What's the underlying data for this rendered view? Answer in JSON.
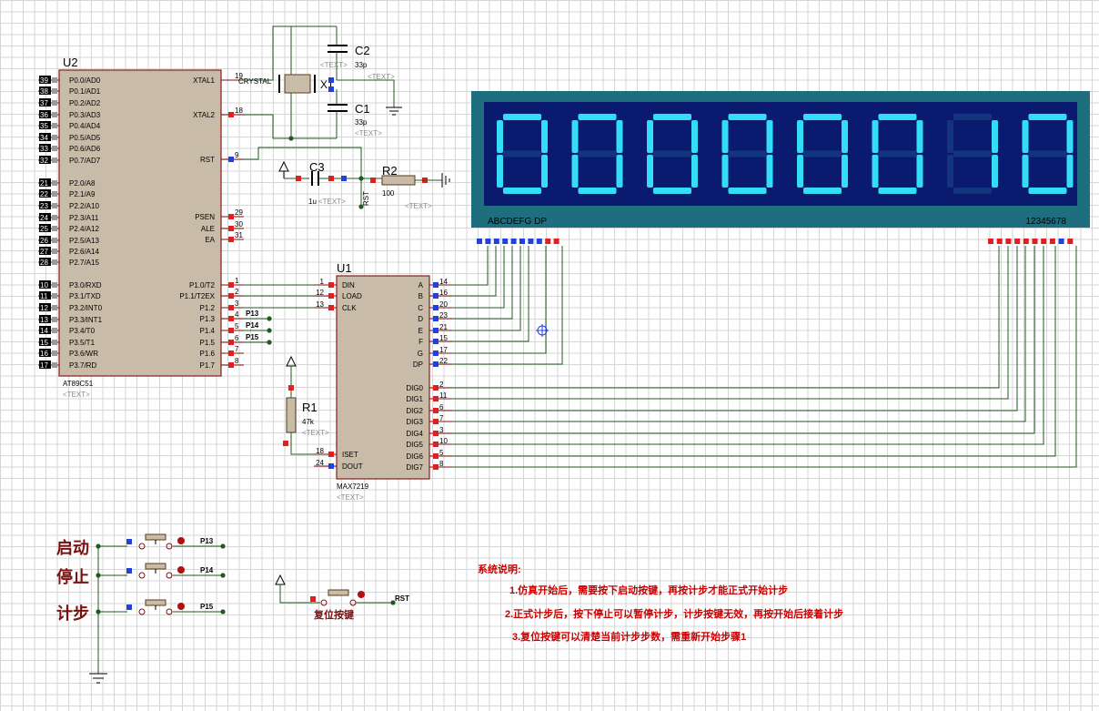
{
  "u2": {
    "ref": "U2",
    "part": "AT89C51",
    "text": "<TEXT>",
    "left_pins": [
      {
        "num": "39",
        "name": "P0.0/AD0"
      },
      {
        "num": "38",
        "name": "P0.1/AD1"
      },
      {
        "num": "37",
        "name": "P0.2/AD2"
      },
      {
        "num": "36",
        "name": "P0.3/AD3"
      },
      {
        "num": "35",
        "name": "P0.4/AD4"
      },
      {
        "num": "34",
        "name": "P0.5/AD5"
      },
      {
        "num": "33",
        "name": "P0.6/AD6"
      },
      {
        "num": "32",
        "name": "P0.7/AD7"
      },
      {
        "num": "21",
        "name": "P2.0/A8"
      },
      {
        "num": "22",
        "name": "P2.1/A9"
      },
      {
        "num": "23",
        "name": "P2.2/A10"
      },
      {
        "num": "24",
        "name": "P2.3/A11"
      },
      {
        "num": "25",
        "name": "P2.4/A12"
      },
      {
        "num": "26",
        "name": "P2.5/A13"
      },
      {
        "num": "27",
        "name": "P2.6/A14"
      },
      {
        "num": "28",
        "name": "P2.7/A15"
      },
      {
        "num": "10",
        "name": "P3.0/RXD"
      },
      {
        "num": "11",
        "name": "P3.1/TXD"
      },
      {
        "num": "12",
        "name": "P3.2/INT0"
      },
      {
        "num": "13",
        "name": "P3.3/INT1"
      },
      {
        "num": "14",
        "name": "P3.4/T0"
      },
      {
        "num": "15",
        "name": "P3.5/T1"
      },
      {
        "num": "16",
        "name": "P3.6/WR"
      },
      {
        "num": "17",
        "name": "P3.7/RD"
      }
    ],
    "right_pins": [
      {
        "num": "19",
        "name": "XTAL1"
      },
      {
        "num": "18",
        "name": "XTAL2"
      },
      {
        "num": "9",
        "name": "RST"
      },
      {
        "num": "29",
        "name": "PSEN"
      },
      {
        "num": "30",
        "name": "ALE"
      },
      {
        "num": "31",
        "name": "EA"
      },
      {
        "num": "1",
        "name": "P1.0/T2"
      },
      {
        "num": "2",
        "name": "P1.1/T2EX"
      },
      {
        "num": "3",
        "name": "P1.2"
      },
      {
        "num": "4",
        "name": "P1.3"
      },
      {
        "num": "5",
        "name": "P1.4"
      },
      {
        "num": "6",
        "name": "P1.5"
      },
      {
        "num": "7",
        "name": "P1.6"
      },
      {
        "num": "8",
        "name": "P1.7"
      }
    ]
  },
  "u1": {
    "ref": "U1",
    "part": "MAX7219",
    "text": "<TEXT>",
    "left_pins": [
      {
        "num": "1",
        "name": "DIN"
      },
      {
        "num": "12",
        "name": "LOAD"
      },
      {
        "num": "13",
        "name": "CLK"
      },
      {
        "num": "18",
        "name": "ISET"
      },
      {
        "num": "24",
        "name": "DOUT"
      }
    ],
    "right_pins": [
      {
        "num": "14",
        "name": "A"
      },
      {
        "num": "16",
        "name": "B"
      },
      {
        "num": "20",
        "name": "C"
      },
      {
        "num": "23",
        "name": "D"
      },
      {
        "num": "21",
        "name": "E"
      },
      {
        "num": "15",
        "name": "F"
      },
      {
        "num": "17",
        "name": "G"
      },
      {
        "num": "22",
        "name": "DP"
      },
      {
        "num": "2",
        "name": "DIG0"
      },
      {
        "num": "11",
        "name": "DIG1"
      },
      {
        "num": "6",
        "name": "DIG2"
      },
      {
        "num": "7",
        "name": "DIG3"
      },
      {
        "num": "3",
        "name": "DIG4"
      },
      {
        "num": "10",
        "name": "DIG5"
      },
      {
        "num": "5",
        "name": "DIG6"
      },
      {
        "num": "8",
        "name": "DIG7"
      }
    ]
  },
  "net_labels": {
    "p13": "P13",
    "p14": "P14",
    "p15": "P15",
    "rst": "RST"
  },
  "crystal": {
    "ref": "X1",
    "value": "CRYSTAL"
  },
  "c1": {
    "ref": "C1",
    "value": "33p",
    "text": "<TEXT>"
  },
  "c2": {
    "ref": "C2",
    "value": "33p",
    "text": "<TEXT>"
  },
  "c3": {
    "ref": "C3",
    "value": "1u",
    "text": "<TEXT>"
  },
  "r1": {
    "ref": "R1",
    "value": "47k",
    "text": "<TEXT>"
  },
  "r2": {
    "ref": "R2",
    "value": "100",
    "text": "<TEXT>"
  },
  "display": {
    "digits": [
      "0",
      "0",
      "0",
      "0",
      "0",
      "0",
      "1",
      "0"
    ],
    "segment_label": "ABCDEFG DP",
    "digit_label": "12345678"
  },
  "buttons": [
    {
      "label": "启动",
      "net": "P13"
    },
    {
      "label": "停止",
      "net": "P14"
    },
    {
      "label": "计步",
      "net": "P15"
    }
  ],
  "reset_button": {
    "label": "复位按键",
    "net": "RST"
  },
  "notes": {
    "title": "系统说明:",
    "lines": [
      "1.仿真开始后，需要按下启动按键，再按计步才能正式开始计步",
      "2.正式计步后，按下停止可以暂停计步，计步按键无效，再按开始后接着计步",
      "3.复位按键可以清楚当前计步步数，需重新开始步骤1"
    ]
  },
  "colors": {
    "chip_fill": "#c8bca8",
    "chip_border": "#8a1c1c",
    "wire": "#1f5a1f",
    "pin_red": "#e02020",
    "pin_blue": "#2040e0",
    "display_bezel": "#1e6e7e",
    "display_face": "#0a1a6e",
    "segment_on": "#33ddf5",
    "segment_off": "#13357e",
    "label_dark_red": "#7a1010",
    "note_red": "#cc0000"
  }
}
